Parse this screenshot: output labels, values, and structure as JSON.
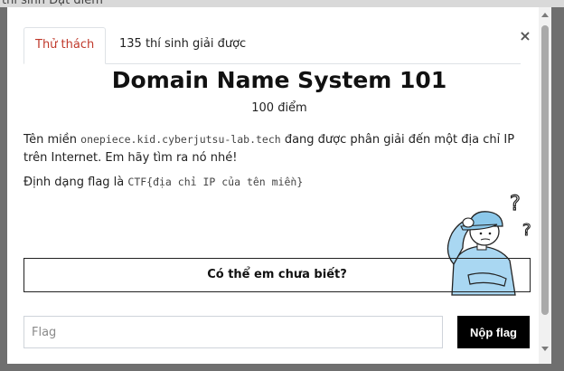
{
  "backdrop": {
    "partial_text": "thí sinh   Đạt điểm"
  },
  "modal": {
    "close_label": "×",
    "tabs": [
      {
        "label": "Thử thách",
        "active": true
      },
      {
        "label": "135 thí sinh giải được",
        "active": false
      }
    ],
    "challenge": {
      "title": "Domain Name System 101",
      "points": "100 điểm",
      "desc_prefix": "Tên miền ",
      "domain": "onepiece.kid.cyberjutsu-lab.tech",
      "desc_suffix": " đang được phân giải đến một địa chỉ IP trên Internet. Em hãy tìm ra nó nhé!",
      "format_prefix": "Định dạng flag là ",
      "format_code": "CTF{địa chỉ IP của tên miền}"
    },
    "hint_label": "Có thể em chưa biết?",
    "flag_placeholder": "Flag",
    "submit_label": "Nộp flag"
  },
  "colors": {
    "active_tab": "#c0392b",
    "submit_bg": "#000000",
    "mascot_shirt": "#a9d7f2",
    "mascot_cap": "#8cc8ea"
  },
  "icons": [
    "close-icon",
    "confused-mascot-illustration"
  ]
}
